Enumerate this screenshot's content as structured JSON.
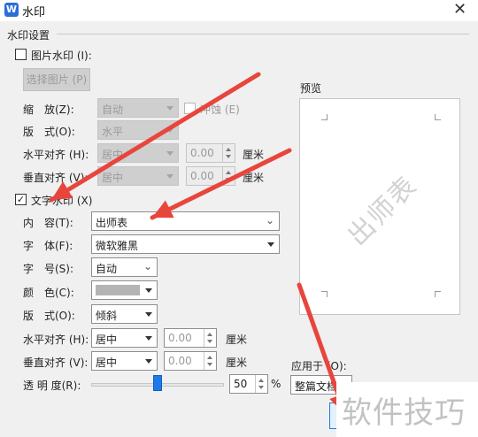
{
  "window": {
    "title": "水印",
    "app_icon_glyph": "W",
    "close_glyph": "✕"
  },
  "group_title": "水印设置",
  "image_wm": {
    "checkbox_label": "图片水印 (I):",
    "checked": false,
    "select_button": "选择图片 (P)",
    "scale_label": "缩　放(Z):",
    "scale_value": "自动",
    "washout_label": "冲蚀 (E)",
    "layout_label": "版　式(O):",
    "layout_value": "水平",
    "h_align_label": "水平对齐 (H):",
    "h_align_value": "居中",
    "h_offset": "0.00",
    "h_unit": "厘米",
    "v_align_label": "垂直对齐 (V):",
    "v_align_value": "居中",
    "v_offset": "0.00",
    "v_unit": "厘米"
  },
  "text_wm": {
    "checkbox_label": "文字水印 (X)",
    "checked": true,
    "content_label": "内　容(T):",
    "content_value": "出师表",
    "font_label": "字　体(F):",
    "font_value": "微软雅黑",
    "size_label": "字　号(S):",
    "size_value": "自动",
    "color_label": "颜　色(C):",
    "color_value": "#b4b4b4",
    "layout_label": "版　式(O):",
    "layout_value": "倾斜",
    "h_align_label": "水平对齐 (H):",
    "h_align_value": "居中",
    "h_offset": "0.00",
    "h_unit": "厘米",
    "v_align_label": "垂直对齐 (V):",
    "v_align_value": "居中",
    "v_offset": "0.00",
    "v_unit": "厘米",
    "transparency_label": "透 明 度(R):",
    "transparency_value": "50",
    "transparency_unit": "%",
    "transparency_fraction": 0.5
  },
  "preview": {
    "label": "预览",
    "watermark_text": "出师表"
  },
  "apply_to": {
    "label": "应用于 (O):",
    "value": "整篇文档"
  },
  "site_watermark": "软件技巧",
  "colors": {
    "accent": "#1e7ae8",
    "arrow": "#e8453c",
    "title_icon": "#2b6fd6"
  }
}
